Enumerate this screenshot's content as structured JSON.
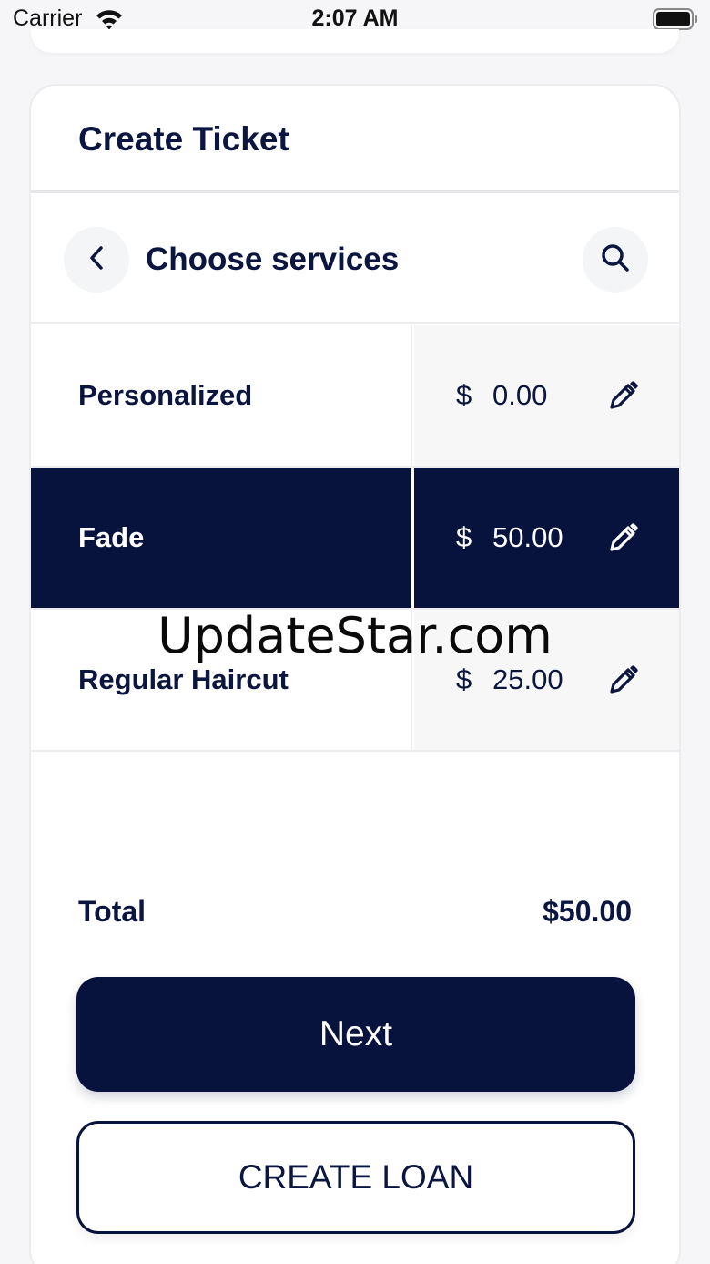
{
  "status_bar": {
    "carrier": "Carrier",
    "time": "2:07 AM"
  },
  "card": {
    "title": "Create Ticket"
  },
  "subheader": {
    "title": "Choose services"
  },
  "services": [
    {
      "name": "Personalized",
      "currency": "$",
      "amount": "0.00",
      "selected": false
    },
    {
      "name": "Fade",
      "currency": "$",
      "amount": "50.00",
      "selected": true
    },
    {
      "name": "Regular Haircut",
      "currency": "$",
      "amount": "25.00",
      "selected": false
    }
  ],
  "total": {
    "label": "Total",
    "value": "$50.00"
  },
  "buttons": {
    "next_label": "Next",
    "loan_label": "CREATE LOAN"
  },
  "watermark": "UpdateStar.com",
  "colors": {
    "primary": "#08133d",
    "text": "#0b1640",
    "price_bg": "#f7f7f8",
    "border": "#ececef"
  },
  "icons": [
    "wifi-icon",
    "battery-icon",
    "chevron-left-icon",
    "search-icon",
    "pencil-icon"
  ]
}
